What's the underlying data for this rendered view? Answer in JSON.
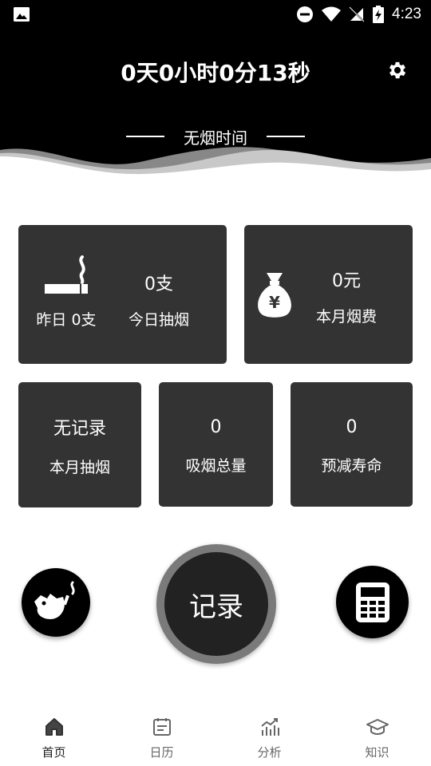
{
  "status_bar": {
    "time": "4:23",
    "icons": [
      "gallery-icon",
      "do-not-disturb-icon",
      "wifi-icon",
      "no-signal-icon",
      "battery-charging-icon"
    ]
  },
  "header": {
    "timer": "0天0小时0分13秒",
    "subtitle": "无烟时间",
    "settings_icon": "gear-icon"
  },
  "cards": {
    "today": {
      "count": "0支",
      "count_label": "今日抽烟",
      "yesterday": "昨日 0支",
      "icon": "cigarette-icon"
    },
    "money": {
      "value": "0元",
      "label": "本月烟费",
      "icon": "money-bag-icon"
    },
    "month": {
      "value": "无记录",
      "label": "本月抽烟"
    },
    "total": {
      "value": "0",
      "label": "吸烟总量"
    },
    "life": {
      "value": "0",
      "label": "预减寿命"
    }
  },
  "actions": {
    "record_label": "记录",
    "left_icon": "quit-smoking-hand-icon",
    "right_icon": "calculator-icon"
  },
  "nav": [
    {
      "label": "首页",
      "icon": "home-icon"
    },
    {
      "label": "日历",
      "icon": "calendar-icon"
    },
    {
      "label": "分析",
      "icon": "chart-icon"
    },
    {
      "label": "知识",
      "icon": "graduation-cap-icon"
    }
  ],
  "colors": {
    "header_bg": "#000000",
    "card_bg": "#333333",
    "record_ring": "#7a7a7a"
  }
}
